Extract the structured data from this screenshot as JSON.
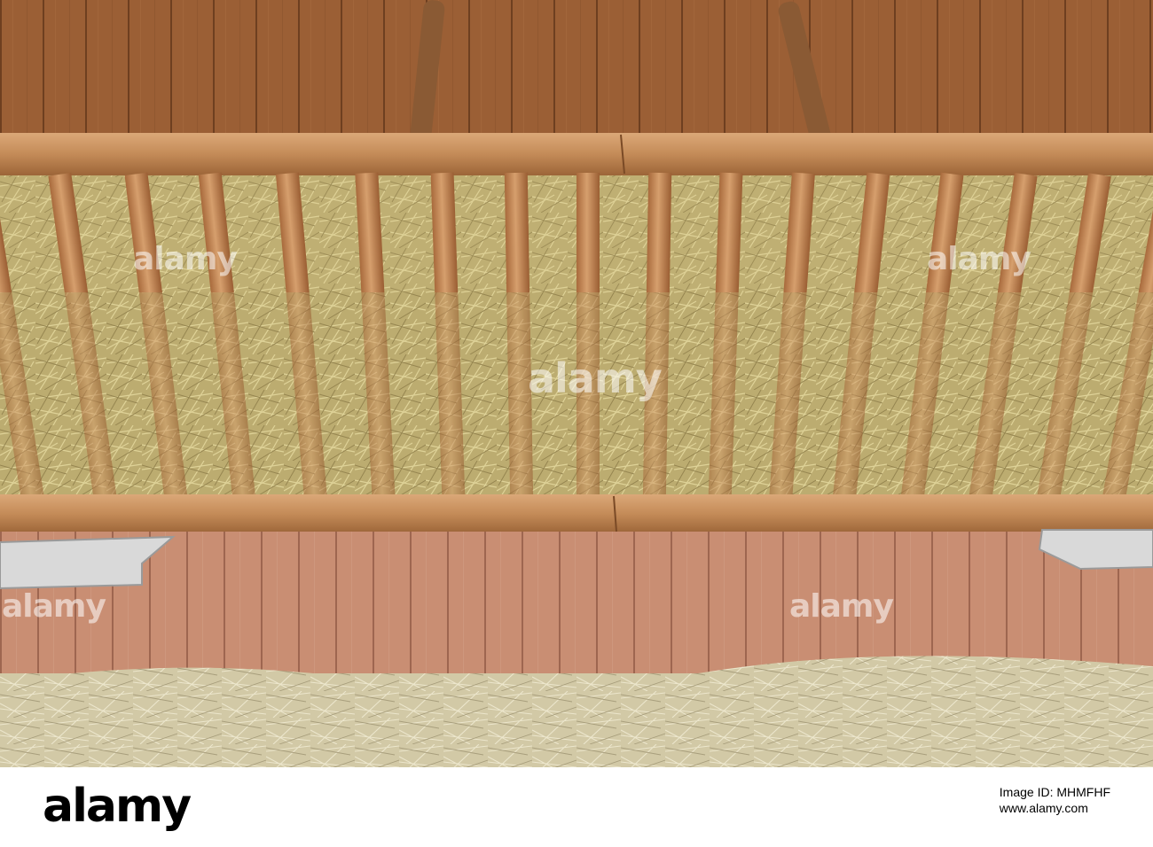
{
  "watermark": {
    "text": "alamy"
  },
  "footer": {
    "logo": "alamy",
    "caption": "Image ID: MHMFHF",
    "url": "www.alamy.com"
  },
  "colors": {
    "wall_planks": "#9b5f35",
    "lower_wall": "#c98e73",
    "rail_wood": "#c9925f",
    "hay": "#c8b77b",
    "floor_hay": "#d6cfb0",
    "metal_tray": "#d9d9d9"
  }
}
